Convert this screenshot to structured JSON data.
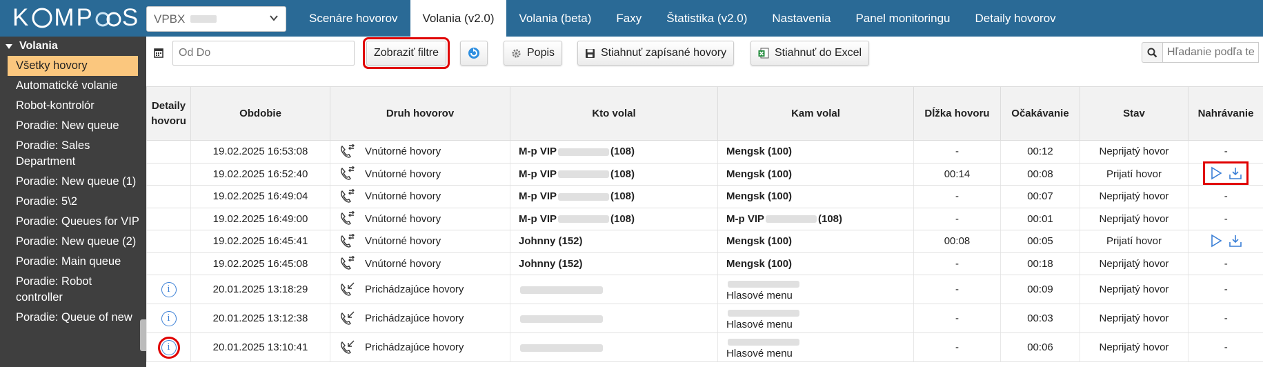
{
  "header": {
    "logo_text_left": "K",
    "logo_text_mid": "MP",
    "logo_text_right": "S",
    "vpbx_label": "VPBX",
    "tabs": [
      {
        "label": "Scenáre hovorov"
      },
      {
        "label": "Volania (v2.0)"
      },
      {
        "label": "Volania (beta)"
      },
      {
        "label": "Faxy"
      },
      {
        "label": "Štatistika (v2.0)"
      },
      {
        "label": "Nastavenia"
      },
      {
        "label": "Panel monitoringu"
      },
      {
        "label": "Detaily hovorov"
      }
    ]
  },
  "sidebar": {
    "section": "Volania",
    "items": [
      {
        "label": "Všetky hovory"
      },
      {
        "label": "Automatické volanie"
      },
      {
        "label": "Robot-kontrolór"
      },
      {
        "label": "Poradie: New queue"
      },
      {
        "label": "Poradie: Sales Department"
      },
      {
        "label": "Poradie: New queue (1)"
      },
      {
        "label": "Poradie: 5\\2"
      },
      {
        "label": "Poradie: Queues for VIP"
      },
      {
        "label": "Poradie: New queue (2)"
      },
      {
        "label": "Poradie: Main queue"
      },
      {
        "label": "Poradie: Robot controller"
      },
      {
        "label": "Poradie: Queue of new"
      }
    ]
  },
  "toolbar": {
    "date_placeholder": "Od Do",
    "show_filters": "Zobraziť filtre",
    "description": "Popis",
    "download_recorded": "Stiahnuť zapísané hovory",
    "download_excel": "Stiahnuť do Excel",
    "search_placeholder": "Hľadanie podľa te"
  },
  "table": {
    "headers": [
      "Detaily hovoru",
      "Obdobie",
      "Druh hovorov",
      "Kto volal",
      "Kam volal",
      "Dĺžka hovoru",
      "Očakávanie",
      "Stav",
      "Nahrávanie"
    ],
    "rows": [
      {
        "period": "19.02.2025 16:53:08",
        "kind": "Vnútorné hovory",
        "from": "M-p VIP",
        "from_ext": "(108)",
        "to": "Mengsk (100)",
        "duration": "-",
        "wait": "00:12",
        "status": "Neprijatý hovor",
        "rec": "-"
      },
      {
        "period": "19.02.2025 16:52:40",
        "kind": "Vnútorné hovory",
        "from": "M-p VIP",
        "from_ext": "(108)",
        "to": "Mengsk (100)",
        "duration": "00:14",
        "wait": "00:08",
        "status": "Prijatí hovor",
        "rec": ""
      },
      {
        "period": "19.02.2025 16:49:04",
        "kind": "Vnútorné hovory",
        "from": "M-p VIP",
        "from_ext": "(108)",
        "to": "Mengsk (100)",
        "duration": "-",
        "wait": "00:07",
        "status": "Neprijatý hovor",
        "rec": "-"
      },
      {
        "period": "19.02.2025 16:49:00",
        "kind": "Vnútorné hovory",
        "from": "M-p VIP",
        "from_ext": "(108)",
        "to": "M-p VIP",
        "to_ext": "(108)",
        "duration": "-",
        "wait": "00:01",
        "status": "Neprijatý hovor",
        "rec": "-"
      },
      {
        "period": "19.02.2025 16:45:41",
        "kind": "Vnútorné hovory",
        "from": "Johnny (152)",
        "to": "Mengsk (100)",
        "duration": "00:08",
        "wait": "00:05",
        "status": "Prijatí hovor",
        "rec": ""
      },
      {
        "period": "19.02.2025 16:45:08",
        "kind": "Vnútorné hovory",
        "from": "Johnny (152)",
        "to": "Mengsk (100)",
        "duration": "-",
        "wait": "00:18",
        "status": "Neprijatý hovor",
        "rec": "-"
      },
      {
        "period": "20.01.2025 13:18:29",
        "kind": "Prichádzajúce hovory",
        "to_sub": "Hlasové menu",
        "duration": "-",
        "wait": "00:09",
        "status": "Neprijatý hovor",
        "rec": "-"
      },
      {
        "period": "20.01.2025 13:12:38",
        "kind": "Prichádzajúce hovory",
        "to_sub": "Hlasové menu",
        "duration": "-",
        "wait": "00:03",
        "status": "Neprijatý hovor",
        "rec": "-"
      },
      {
        "period": "20.01.2025 13:10:41",
        "kind": "Prichádzajúce hovory",
        "to_sub": "Hlasové menu",
        "duration": "-",
        "wait": "00:06",
        "status": "Neprijatý hovor",
        "rec": "-"
      }
    ]
  },
  "colors": {
    "header_bg": "#2a6a96",
    "sidebar_bg": "#3f3f3f",
    "active_item": "#fbc77e",
    "highlight": "#e00000",
    "link_blue": "#3a7fd6"
  }
}
